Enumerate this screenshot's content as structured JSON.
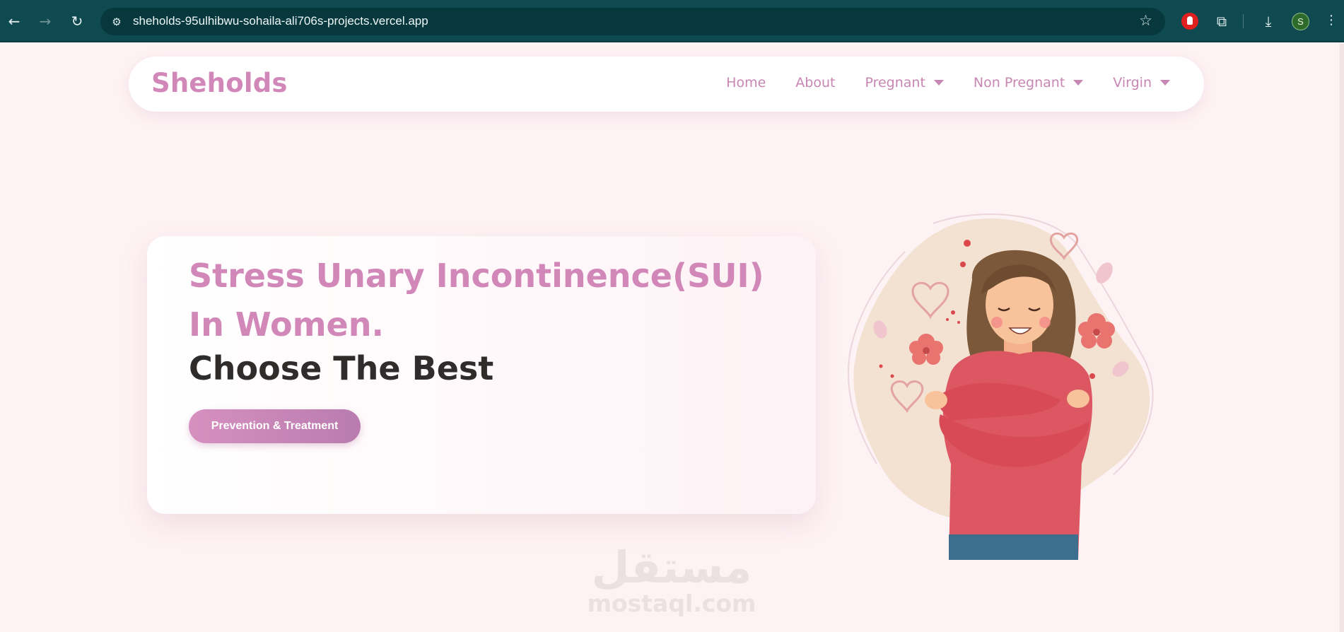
{
  "browser": {
    "url": "sheholds-95ulhibwu-sohaila-ali706s-projects.vercel.app",
    "profile_initial": "S",
    "icons": {
      "back": "arrow-left-icon",
      "forward": "arrow-right-icon",
      "reload": "reload-icon",
      "site_info": "tune-icon",
      "bookmark": "star-icon",
      "extension": "extension-red-icon",
      "extensions": "puzzle-icon",
      "download": "download-icon",
      "menu": "kebab-icon"
    }
  },
  "navbar": {
    "brand": "Sheholds",
    "links": [
      {
        "label": "Home",
        "dropdown": false
      },
      {
        "label": "About",
        "dropdown": false
      },
      {
        "label": "Pregnant",
        "dropdown": true
      },
      {
        "label": "Non Pregnant",
        "dropdown": true
      },
      {
        "label": "Virgin",
        "dropdown": true
      }
    ]
  },
  "hero": {
    "title": "Stress Unary Incontinence(SUI) In Women.",
    "subtitle": "Choose The Best",
    "cta_label": "Prevention & Treatment"
  },
  "watermark": {
    "arabic": "مستقل",
    "latin": "mostaql.com"
  },
  "colors": {
    "brand_pink": "#d187b8",
    "page_bg": "#fdf2f4",
    "chrome_bg": "#0e4a50",
    "heading_dark": "#2f2c2c"
  }
}
